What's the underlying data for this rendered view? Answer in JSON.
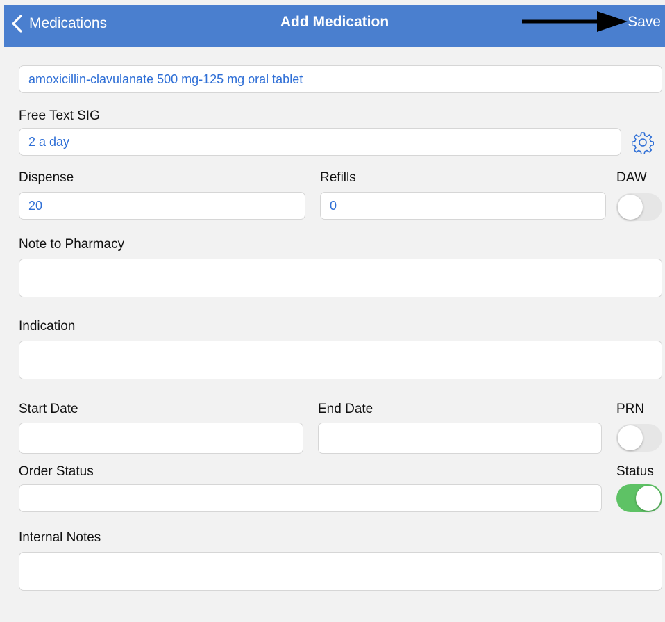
{
  "nav": {
    "back_label": "Medications",
    "title": "Add Medication",
    "save_label": "Save"
  },
  "form": {
    "medication": {
      "value": "amoxicillin-clavulanate 500 mg-125 mg oral tablet"
    },
    "sig": {
      "label": "Free Text SIG",
      "value": "2 a day"
    },
    "dispense": {
      "label": "Dispense",
      "value": "20"
    },
    "refills": {
      "label": "Refills",
      "value": "0"
    },
    "daw": {
      "label": "DAW",
      "on": false
    },
    "note_to_pharmacy": {
      "label": "Note to Pharmacy",
      "value": ""
    },
    "indication": {
      "label": "Indication",
      "value": ""
    },
    "start_date": {
      "label": "Start Date",
      "value": ""
    },
    "end_date": {
      "label": "End Date",
      "value": ""
    },
    "prn": {
      "label": "PRN",
      "on": false
    },
    "order_status": {
      "label": "Order Status",
      "value": ""
    },
    "status": {
      "label": "Status",
      "on": true
    },
    "internal_notes": {
      "label": "Internal Notes",
      "value": ""
    }
  },
  "icons": {
    "back": "chevron-left-icon",
    "settings": "gear-icon",
    "annotation": "arrow-right-icon"
  },
  "colors": {
    "nav_bar": "#4a7fcf",
    "field_text": "#2f6fd6",
    "toggle_on": "#5ec265",
    "toggle_off": "#e6e6e6",
    "background": "#f2f2f2"
  }
}
